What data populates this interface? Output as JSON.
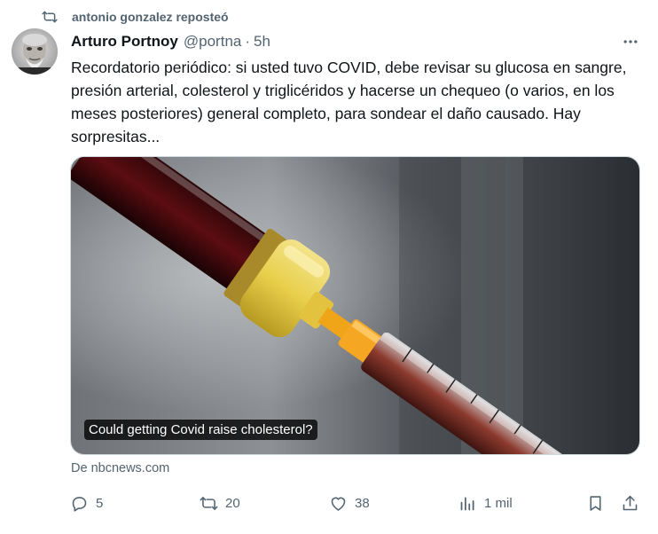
{
  "repost": {
    "text": "antonio gonzalez reposteó",
    "icon": "repost-icon"
  },
  "post": {
    "author_name": "Arturo Portnoy",
    "handle": "@portna",
    "separator": "·",
    "time": "5h",
    "text": "Recordatorio periódico: si usted tuvo COVID, debe revisar su glucosa en sangre, presión arterial, colesterol y triglicéridos y hacerse un chequeo (o varios, en los meses posteriores) general completo, para sondear el daño causado. Hay sorpresitas...",
    "more_icon": "more-horizontal-icon"
  },
  "card": {
    "caption": "Could getting Covid raise cholesterol?",
    "source": "De nbcnews.com"
  },
  "actions": {
    "replies": "5",
    "reposts": "20",
    "likes": "38",
    "views": "1 mil"
  },
  "colors": {
    "text": "#0f1419",
    "secondary": "#536471",
    "border": "#cfd9de"
  }
}
